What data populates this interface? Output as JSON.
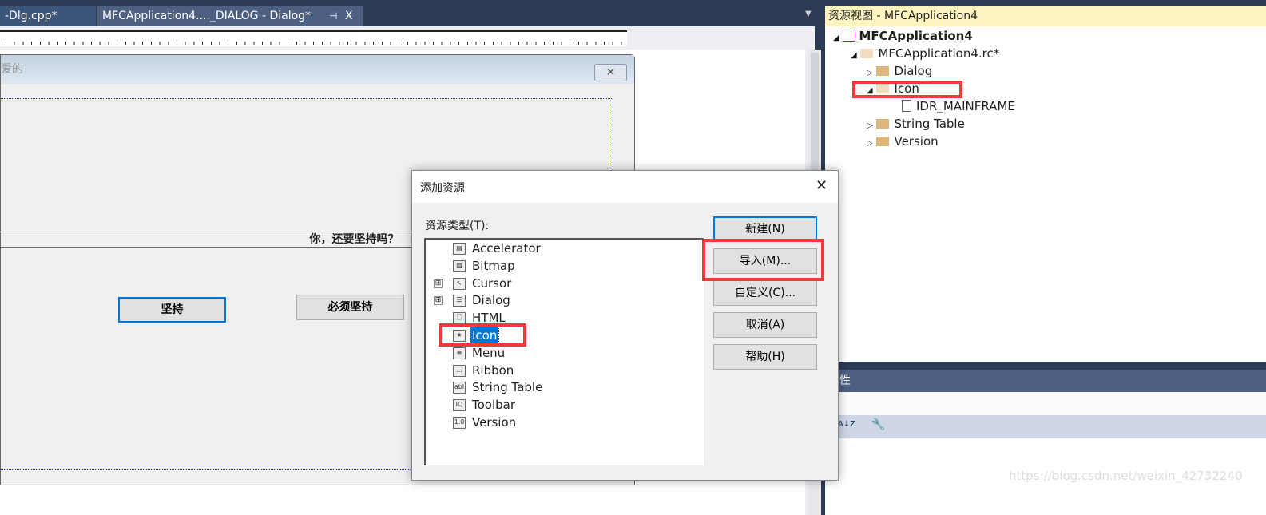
{
  "tabs": [
    {
      "label": "-Dlg.cpp*"
    },
    {
      "label": "MFCApplication4...._DIALOG - Dialog*",
      "pin": "⊣",
      "close": "X"
    }
  ],
  "designer": {
    "title_fragment": "爱的",
    "close": "✕",
    "static_text": "你，还要坚持吗？",
    "buttons": [
      "坚持",
      "必须坚持"
    ]
  },
  "add_resource_dialog": {
    "title": "添加资源",
    "close": "✕",
    "list_label": "资源类型(T):",
    "items": [
      {
        "label": "Accelerator",
        "icon": "accelerator-icon",
        "glyph": "▤"
      },
      {
        "label": "Bitmap",
        "icon": "bitmap-icon",
        "glyph": "▨"
      },
      {
        "label": "Cursor",
        "icon": "cursor-icon",
        "glyph": "↖",
        "expandable": true
      },
      {
        "label": "Dialog",
        "icon": "dialog-icon",
        "glyph": "☰",
        "expandable": true
      },
      {
        "label": "HTML",
        "icon": "html-icon",
        "glyph": "🗋"
      },
      {
        "label": "Icon",
        "icon": "icon-resource-icon",
        "glyph": "★",
        "selected": true
      },
      {
        "label": "Menu",
        "icon": "menu-icon",
        "glyph": "≡"
      },
      {
        "label": "Ribbon",
        "icon": "ribbon-icon",
        "glyph": "…"
      },
      {
        "label": "String Table",
        "icon": "string-table-icon",
        "glyph": "abl"
      },
      {
        "label": "Toolbar",
        "icon": "toolbar-icon",
        "glyph": "IO"
      },
      {
        "label": "Version",
        "icon": "version-icon",
        "glyph": "1.0"
      }
    ],
    "expand_glyph": "⊞",
    "buttons": {
      "new": "新建(N)",
      "import": "导入(M)...",
      "custom": "自定义(C)...",
      "cancel": "取消(A)",
      "help": "帮助(H)"
    }
  },
  "resource_view": {
    "title": "资源视图 - MFCApplication4",
    "project": "MFCApplication4",
    "rc_file": "MFCApplication4.rc*",
    "folders": [
      "Dialog",
      "Icon",
      "String Table",
      "Version"
    ],
    "icon_child": "IDR_MAINFRAME"
  },
  "properties": {
    "title_fragment": "性",
    "sort_glyph": "A↓Z"
  },
  "watermark": "https://blog.csdn.net/weixin_42732240",
  "colors": {
    "accent": "#0078d7",
    "highlight": "#f03a3a",
    "header_yellow": "#fdf4bf",
    "vs_navy": "#2b3a55"
  }
}
